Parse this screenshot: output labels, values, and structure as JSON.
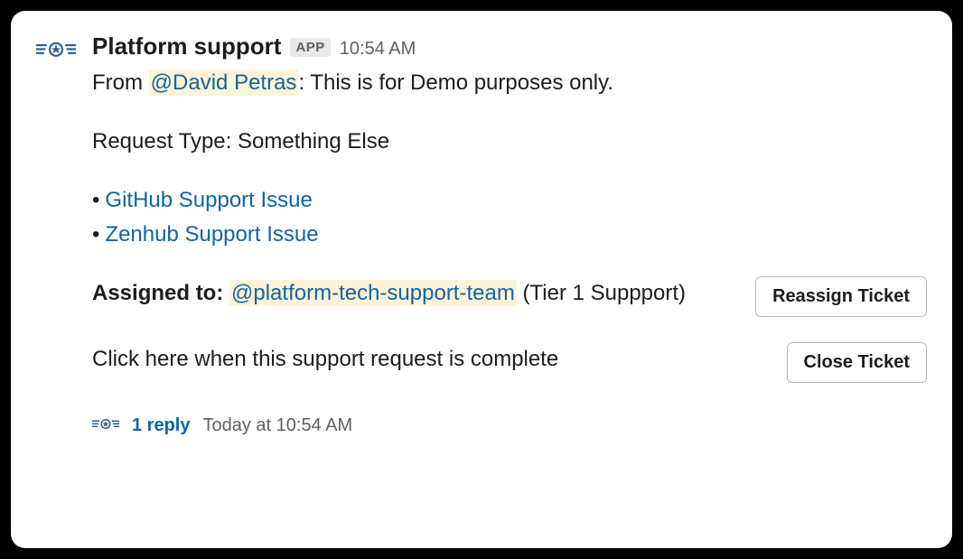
{
  "message": {
    "author": "Platform support",
    "app_badge": "APP",
    "timestamp": "10:54 AM",
    "from_prefix": "From ",
    "from_mention": "@David Petras",
    "from_suffix": ": This is for Demo purposes only.",
    "request_type": "Request Type: Something Else",
    "links": [
      "GitHub Support Issue",
      "Zenhub Support Issue"
    ],
    "assigned": {
      "label": "Assigned to: ",
      "mention": "@platform-tech-support-team",
      "suffix": " (Tier 1 Suppport)"
    },
    "complete_prompt": "Click here when this support request is complete",
    "buttons": {
      "reassign": "Reassign Ticket",
      "close": "Close Ticket"
    },
    "thread": {
      "reply_count": "1 reply",
      "reply_time": "Today at 10:54 AM"
    }
  }
}
